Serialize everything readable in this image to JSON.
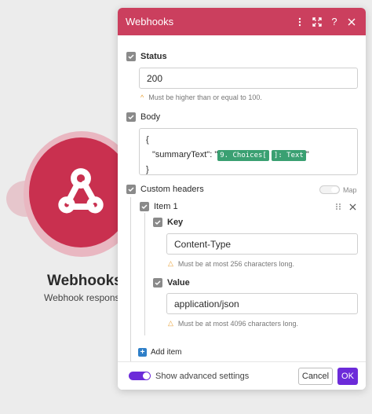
{
  "canvas": {
    "module_title": "Webhooks",
    "module_subtitle": "Webhook respons",
    "module_icon": "webhook-icon",
    "accent": "#c9304f"
  },
  "dialog": {
    "title": "Webhooks",
    "header_color": "#cb3f5e",
    "header_icons": [
      "more-vertical-icon",
      "expand-icon",
      "help-icon",
      "close-icon"
    ]
  },
  "status": {
    "label": "Status",
    "value": "200",
    "hint": "Must be higher than or equal to 100."
  },
  "body": {
    "label": "Body",
    "line_open": "{",
    "key": "\"summaryText\": \"",
    "pill_1": "9. Choices[",
    "pill_2": "]: Text",
    "suffix": "\"",
    "line_close": "}"
  },
  "custom_headers": {
    "label": "Custom headers",
    "map_label": "Map",
    "item_label": "Item 1",
    "key_label": "Key",
    "key_value": "Content-Type",
    "key_hint": "Must be at most 256 characters long.",
    "value_label": "Value",
    "value_value": "application/json",
    "value_hint": "Must be at most 4096 characters long.",
    "add_item": "Add item"
  },
  "footer": {
    "advanced_label": "Show advanced settings",
    "advanced_on": true,
    "cancel": "Cancel",
    "ok": "OK",
    "primary_color": "#6c2bd9"
  }
}
